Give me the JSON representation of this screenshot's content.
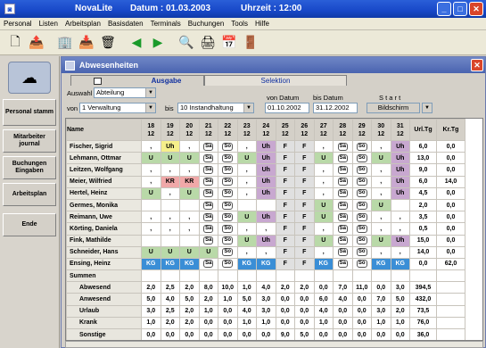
{
  "window": {
    "app": "NovaLite",
    "datum_label": "Datum : 01.03.2003",
    "uhrzeit_label": "Uhrzeit : 12:00"
  },
  "menu": [
    "Personal",
    "Listen",
    "Arbeitsplan",
    "Basisdaten",
    "Terminals",
    "Buchungen",
    "Tools",
    "Hilfe"
  ],
  "sidebar": [
    {
      "label": "Personal stamm"
    },
    {
      "label": "Mitarbeiter journal"
    },
    {
      "label": "Buchungen Eingaben"
    },
    {
      "label": "Arbeitsplan"
    },
    {
      "label": "Ende"
    }
  ],
  "child": {
    "title": "Abwesenheiten"
  },
  "tabs": {
    "ausgabe": "Ausgabe",
    "selektion": "Selektion"
  },
  "filter": {
    "auswahl_label": "Auswahl",
    "auswahl_value": "Abteilung",
    "von_label": "von",
    "von_value": "1 Verwaltung",
    "bis_label": "bis",
    "bis_value": "10 Instandhaltung",
    "von_datum_label": "von Datum",
    "von_datum_value": "01.10.2002",
    "bis_datum_label": "bis Datum",
    "bis_datum_value": "31.12.2002",
    "start_label": "S t a r t",
    "start_value": "Bildschirm"
  },
  "table": {
    "name_header": "Name",
    "days": [
      "18\n12",
      "19\n12",
      "20\n12",
      "21\n12",
      "22\n12",
      "23\n12",
      "24\n12",
      "25\n12",
      "26\n12",
      "27\n12",
      "28\n12",
      "29\n12",
      "30\n12",
      "31\n12"
    ],
    "urltg_header": "Url.Tg",
    "krtg_header": "Kr.Tg",
    "rows": [
      {
        "name": "Fischer, Sigrid",
        "cells": [
          ",",
          "Uh",
          ",",
          "Sa",
          "So",
          ",",
          "Uh",
          "F",
          "F",
          ",",
          "Sa",
          "So",
          ",",
          "Uh"
        ],
        "urltg": "6,0",
        "krtg": "0,0"
      },
      {
        "name": "Lehmann, Ottmar",
        "cells": [
          "U",
          "U",
          "U",
          "Sa",
          "So",
          "U",
          "Uh",
          "F",
          "F",
          "U",
          "Sa",
          "So",
          "U",
          "Uh"
        ],
        "urltg": "13,0",
        "krtg": "0,0"
      },
      {
        "name": "Leitzen, Wolfgang",
        "cells": [
          ",",
          ",",
          ",",
          "Sa",
          "So",
          ",",
          "Uh",
          "F",
          "F",
          ",",
          "Sa",
          "So",
          ",",
          "Uh"
        ],
        "urltg": "9,0",
        "krtg": "0,0"
      },
      {
        "name": "Meier, Wilfried",
        "cells": [
          ",",
          "KR",
          "KR",
          "Sa",
          "So",
          ",",
          "Uh",
          "F",
          "F",
          ",",
          "Sa",
          "So",
          ",",
          "Uh"
        ],
        "urltg": "6,0",
        "krtg": "14,0"
      },
      {
        "name": "Hertel, Heinz",
        "cells": [
          "U",
          ",",
          "U",
          "Sa",
          "So",
          ",",
          "Uh",
          "F",
          "F",
          ",",
          "Sa",
          "So",
          ",",
          "Uh"
        ],
        "urltg": "4,5",
        "krtg": "0,0"
      },
      {
        "name": "Germes, Monika",
        "cells": [
          "",
          "",
          "",
          "Sa",
          "So",
          "",
          "",
          "F",
          "F",
          "U",
          "Sa",
          "So",
          "U",
          ""
        ],
        "urltg": "2,0",
        "krtg": "0,0"
      },
      {
        "name": "Reimann, Uwe",
        "cells": [
          ",",
          ",",
          ",",
          "Sa",
          "So",
          "U",
          "Uh",
          "F",
          "F",
          "U",
          "Sa",
          "So",
          ",",
          ","
        ],
        "urltg": "3,5",
        "krtg": "0,0"
      },
      {
        "name": "Körting, Daniela",
        "cells": [
          ",",
          ",",
          ",",
          "Sa",
          "So",
          ",",
          ",",
          "F",
          "F",
          ",",
          "Sa",
          "So",
          ",",
          ","
        ],
        "urltg": "0,5",
        "krtg": "0,0"
      },
      {
        "name": "Fink, Mathilde",
        "cells": [
          "",
          "",
          "",
          "Sa",
          "So",
          "U",
          "Uh",
          "F",
          "F",
          "U",
          "Sa",
          "So",
          "U",
          "Uh"
        ],
        "urltg": "15,0",
        "krtg": "0,0"
      },
      {
        "name": "Schneider, Hans",
        "cells": [
          "U",
          "U",
          "U",
          "U",
          "So",
          ",",
          ",",
          "F",
          "F",
          ",",
          "Sa",
          "So",
          ",",
          ","
        ],
        "urltg": "14,0",
        "krtg": "0,0"
      },
      {
        "name": "Ensing, Heinz",
        "cells": [
          "KG",
          "KG",
          "KG",
          "Sa",
          "So",
          "KG",
          "KG",
          "F",
          "F",
          "KG",
          "Sa",
          "So",
          "KG",
          "KG"
        ],
        "urltg": "0,0",
        "krtg": "62,0"
      }
    ],
    "summen_label": "Summen",
    "sums": [
      {
        "label": "Abwesend",
        "cells": [
          "2,0",
          "2,5",
          "2,0",
          "8,0",
          "10,0",
          "1,0",
          "4,0",
          "2,0",
          "2,0",
          "0,0",
          "7,0",
          "11,0",
          "0,0",
          "3,0"
        ],
        "urltg": "394,5",
        "krtg": ""
      },
      {
        "label": "Anwesend",
        "cells": [
          "5,0",
          "4,0",
          "5,0",
          "2,0",
          "1,0",
          "5,0",
          "3,0",
          "0,0",
          "0,0",
          "6,0",
          "4,0",
          "0,0",
          "7,0",
          "5,0"
        ],
        "urltg": "432,0",
        "krtg": ""
      },
      {
        "label": "Urlaub",
        "cells": [
          "3,0",
          "2,5",
          "2,0",
          "1,0",
          "0,0",
          "4,0",
          "3,0",
          "0,0",
          "0,0",
          "4,0",
          "0,0",
          "0,0",
          "3,0",
          "2,0"
        ],
        "urltg": "73,5",
        "krtg": ""
      },
      {
        "label": "Krank",
        "cells": [
          "1,0",
          "2,0",
          "2,0",
          "0,0",
          "0,0",
          "1,0",
          "1,0",
          "0,0",
          "0,0",
          "1,0",
          "0,0",
          "0,0",
          "1,0",
          "1,0"
        ],
        "urltg": "76,0",
        "krtg": ""
      },
      {
        "label": "Sonstige",
        "cells": [
          "0,0",
          "0,0",
          "0,0",
          "0,0",
          "0,0",
          "0,0",
          "0,0",
          "9,0",
          "5,0",
          "0,0",
          "0,0",
          "0,0",
          "0,0",
          "0,0"
        ],
        "urltg": "36,0",
        "krtg": ""
      }
    ]
  }
}
